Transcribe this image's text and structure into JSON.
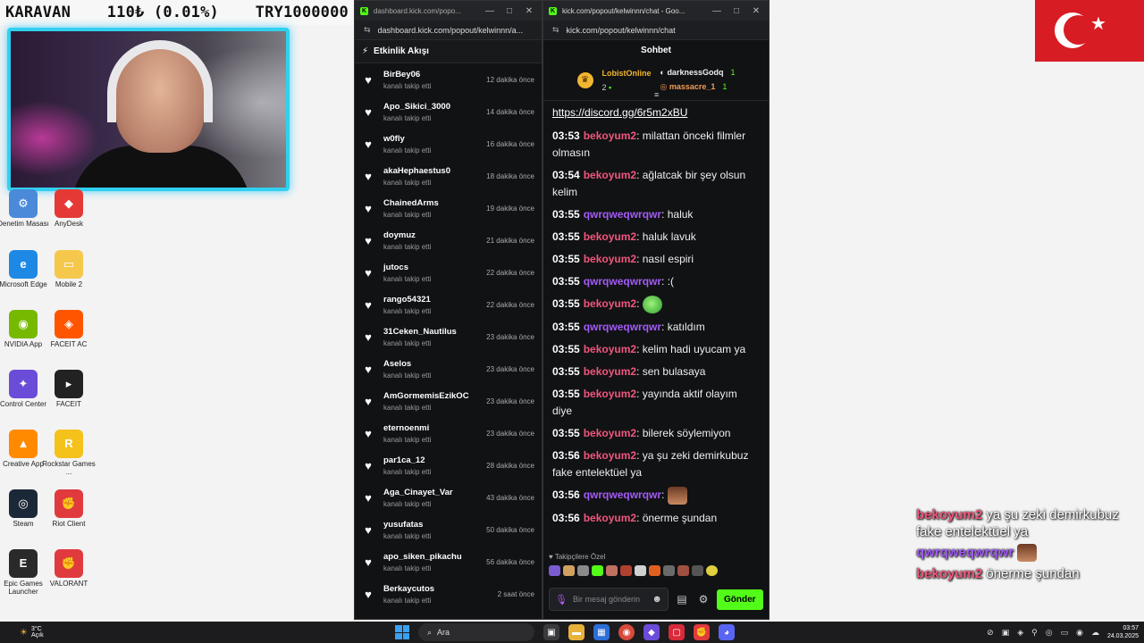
{
  "ticker": {
    "name": "KARAVAN",
    "price": "110₺ (0.01%)",
    "balance": "TRY1000000"
  },
  "desktop_icons": [
    {
      "label": "Denetim Masası",
      "color": "#4a8ad8",
      "glyph": "⚙"
    },
    {
      "label": "AnyDesk",
      "color": "#e53935",
      "glyph": "◆"
    },
    {
      "label": "Microsoft Edge",
      "color": "#1e88e5",
      "glyph": "e"
    },
    {
      "label": "Mobile 2",
      "color": "#f5c84c",
      "glyph": "▭"
    },
    {
      "label": "NVIDIA App",
      "color": "#76b900",
      "glyph": "◉"
    },
    {
      "label": "FACEIT AC",
      "color": "#ff5500",
      "glyph": "◈"
    },
    {
      "label": "Control Center",
      "color": "#6a4cd8",
      "glyph": "✦"
    },
    {
      "label": "FACEIT",
      "color": "#222222",
      "glyph": "▸"
    },
    {
      "label": "Creative App",
      "color": "#ff8a00",
      "glyph": "▲"
    },
    {
      "label": "Rockstar Games ...",
      "color": "#f5c21c",
      "glyph": "R"
    },
    {
      "label": "Steam",
      "color": "#1b2838",
      "glyph": "◎"
    },
    {
      "label": "Riot Client",
      "color": "#e03a3e",
      "glyph": "✊"
    },
    {
      "label": "Epic Games Launcher",
      "color": "#2a2a2a",
      "glyph": "E"
    },
    {
      "label": "VALORANT",
      "color": "#e03a3e",
      "glyph": "✊"
    }
  ],
  "dashboard_window": {
    "tab_title": "dashboard.kick.com/popo...",
    "url": "dashboard.kick.com/popout/kelwinnn/a...",
    "feed_title": "Etkinlik Akışı",
    "action_text": "kanalı takip etti",
    "events": [
      {
        "user": "BirBey06",
        "time": "12 dakika önce"
      },
      {
        "user": "Apo_Sikici_3000",
        "time": "14 dakika önce"
      },
      {
        "user": "w0fly",
        "time": "16 dakika önce"
      },
      {
        "user": "akaHephaestus0",
        "time": "18 dakika önce"
      },
      {
        "user": "ChainedArms",
        "time": "19 dakika önce"
      },
      {
        "user": "doymuz",
        "time": "21 dakika önce"
      },
      {
        "user": "jutocs",
        "time": "22 dakika önce"
      },
      {
        "user": "rango54321",
        "time": "22 dakika önce"
      },
      {
        "user": "31Ceken_Nautilus",
        "time": "23 dakika önce"
      },
      {
        "user": "Aselos",
        "time": "23 dakika önce"
      },
      {
        "user": "AmGormemisEzikOC",
        "time": "23 dakika önce"
      },
      {
        "user": "eternoenmi",
        "time": "23 dakika önce"
      },
      {
        "user": "par1ca_12",
        "time": "28 dakika önce"
      },
      {
        "user": "Aga_Cinayet_Var",
        "time": "43 dakika önce"
      },
      {
        "user": "yusufatas",
        "time": "50 dakika önce"
      },
      {
        "user": "apo_siken_pikachu",
        "time": "56 dakika önce"
      },
      {
        "user": "Berkaycutos",
        "time": "2 saat önce"
      }
    ]
  },
  "chat_window": {
    "tab_title": "kick.com/popout/kelwinnn/chat - Goo...",
    "url": "kick.com/popout/kelwinnn/chat",
    "header": "Sohbet",
    "pinned": {
      "top_user": "LobistOnline",
      "top_count": "2",
      "second_user": "darknessGodq",
      "second_count": "1",
      "third_user": "massacre_1",
      "third_count": "1"
    },
    "link": "https://discord.gg/6r5m2xBU",
    "messages": [
      {
        "time": "03:53",
        "user": "bekoyum2",
        "color": "pink",
        "text": "milattan önceki filmler olmasın"
      },
      {
        "time": "03:54",
        "user": "bekoyum2",
        "color": "pink",
        "text": "ağlatcak bir şey olsun kelim"
      },
      {
        "time": "03:55",
        "user": "qwrqweqwrqwr",
        "color": "purple",
        "text": "haluk"
      },
      {
        "time": "03:55",
        "user": "bekoyum2",
        "color": "pink",
        "text": "haluk lavuk"
      },
      {
        "time": "03:55",
        "user": "bekoyum2",
        "color": "pink",
        "text": "nasıl espiri"
      },
      {
        "time": "03:55",
        "user": "qwrqweqwrqwr",
        "color": "purple",
        "text": ":("
      },
      {
        "time": "03:55",
        "user": "bekoyum2",
        "color": "pink",
        "text": "",
        "emote": "green"
      },
      {
        "time": "03:55",
        "user": "qwrqweqwrqwr",
        "color": "purple",
        "text": "katıldım"
      },
      {
        "time": "03:55",
        "user": "bekoyum2",
        "color": "pink",
        "text": "kelim hadi uyucam ya"
      },
      {
        "time": "03:55",
        "user": "bekoyum2",
        "color": "pink",
        "text": "sen bulasaya"
      },
      {
        "time": "03:55",
        "user": "bekoyum2",
        "color": "pink",
        "text": "yayında aktif olayım diye"
      },
      {
        "time": "03:55",
        "user": "bekoyum2",
        "color": "pink",
        "text": "bilerek söylemiyon"
      },
      {
        "time": "03:56",
        "user": "bekoyum2",
        "color": "pink",
        "text": "ya şu zeki demirkubuz fake entelektüel ya"
      },
      {
        "time": "03:56",
        "user": "qwrqweqwrqwr",
        "color": "purple",
        "text": "",
        "emote": "face"
      },
      {
        "time": "03:56",
        "user": "bekoyum2",
        "color": "pink",
        "text": "önerme şundan"
      }
    ],
    "followers_only": "Takipçilere Özel",
    "input_placeholder": "Bir mesaj gönderin",
    "send_label": "Gönder"
  },
  "overlay_chat": [
    {
      "user": "bekoyum2",
      "color": "pink",
      "text": "ya şu zeki demirkubuz fake entelektüel ya"
    },
    {
      "user": "qwrqweqwrqwr",
      "color": "purple",
      "text": "",
      "emote": "face"
    },
    {
      "user": "bekoyum2",
      "color": "pink",
      "text": "önerme şundan"
    }
  ],
  "taskbar": {
    "temp": "3°C",
    "weather": "Açık",
    "search_label": "Ara",
    "time": "03:57",
    "date": "24.03.2025"
  }
}
